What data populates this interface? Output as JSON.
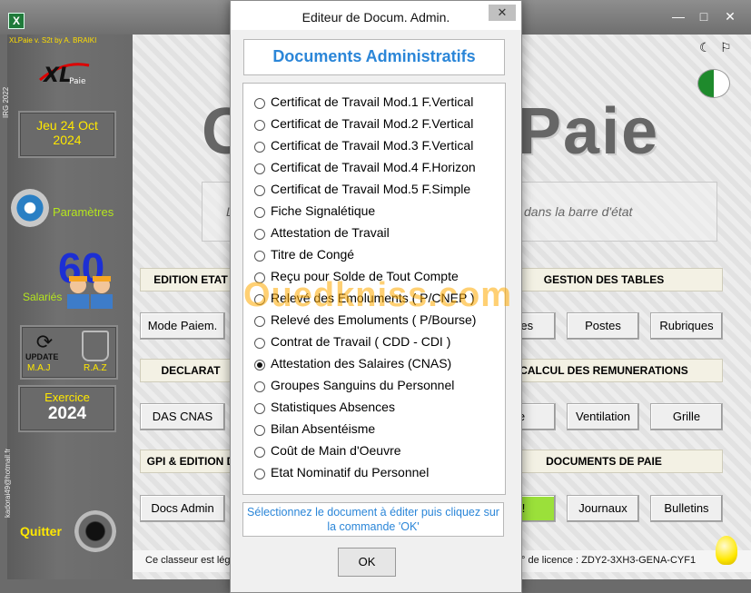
{
  "window": {
    "icon_letter": "X",
    "min": "—",
    "max": "□",
    "close": "✕"
  },
  "left": {
    "brand": "XLPaie v. S2t  by A. BRAIKI",
    "side_text": "IRG 2022",
    "logo": "XLPaie",
    "date_line1": "Jeu 24 Oct",
    "date_line2": "2024",
    "params": "Paramètres",
    "employees_count": "60",
    "employees_label": "Salariés",
    "update_title": "UPDATE",
    "update_label": "M.A.J",
    "reset_label": "R.A.Z",
    "exercise_label": "Exercice",
    "exercise_year": "2024",
    "email": "kadorai49@hotmail.fr",
    "quit": "Quitter"
  },
  "main": {
    "title_left": "C",
    "title_right": "Paie",
    "status_hint": "dans la barre d'état",
    "status_hint_left": "L",
    "headers": {
      "edition": "EDITION ETAT",
      "gestion": "GESTION DES TABLES",
      "declar": "DECLARAT",
      "calcul": "CALCUL DES REMUNERATIONS",
      "gpi": "GPI & EDITION D",
      "docs": "DOCUMENTS DE PAIE"
    },
    "buttons": {
      "mode_paiem": "Mode Paiem.",
      "ques": "ques",
      "postes": "Postes",
      "rubriques": "Rubriques",
      "das_cnas": "DAS CNAS",
      "ie": "ie",
      "ventilation": "Ventilation",
      "grille": "Grille",
      "docs_admin": "Docs Admin",
      "green": "t !",
      "journaux": "Journaux",
      "bulletins": "Bulletins"
    },
    "footer_left": "Ce classeur est lég",
    "footer_right": "° de licence : ZDY2-3XH3-GENA-CYF1",
    "watermark": "Ouedkniss.com"
  },
  "dialog": {
    "title": "Editeur de Docum. Admin.",
    "close": "✕",
    "heading": "Documents Administratifs",
    "options": [
      "Certificat de Travail Mod.1 F.Vertical",
      "Certificat de Travail Mod.2 F.Vertical",
      "Certificat de Travail Mod.3 F.Vertical",
      "Certificat de Travail Mod.4 F.Horizon",
      "Certificat de Travail Mod.5 F.Simple",
      "Fiche Signalétique",
      "Attestation de Travail",
      "Titre de Congé",
      "Reçu pour Solde de Tout Compte",
      "Relevé des Emoluments ( P/CNEP )",
      "Relevé des Emoluments ( P/Bourse)",
      "Contrat de Travail ( CDD - CDI )",
      "Attestation des Salaires (CNAS)",
      "Groupes Sanguins du Personnel",
      "Statistiques Absences",
      "Bilan Absentéisme",
      "Coût de Main d'Oeuvre",
      "Etat Nominatif du Personnel"
    ],
    "selected": "Attestation des Salaires (CNAS)",
    "hint": "Sélectionnez le document à éditer puis cliquez sur la commande 'OK'",
    "ok": "OK"
  },
  "colors": {
    "accent_blue": "#2b86d8",
    "yellow": "#ffe800",
    "green_label": "#b5e61d",
    "count_blue": "#1c2fd4"
  }
}
